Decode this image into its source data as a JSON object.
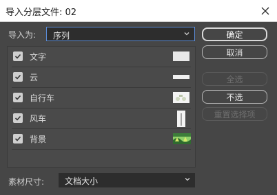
{
  "window": {
    "title": "导入分层文件: 02"
  },
  "import_as": {
    "label": "导入为:",
    "value": "序列"
  },
  "layers": [
    {
      "name": "文字",
      "checked": true
    },
    {
      "name": "云",
      "checked": true
    },
    {
      "name": "自行车",
      "checked": true
    },
    {
      "name": "风车",
      "checked": true
    },
    {
      "name": "背景",
      "checked": true
    }
  ],
  "footage": {
    "label": "素材尺寸:",
    "value": "文档大小"
  },
  "buttons": {
    "ok": "确定",
    "cancel": "取消",
    "select_all": "全选",
    "deselect": "不选",
    "reset": "重置选择项"
  },
  "colors": {
    "focus": "#5a8bd6",
    "panel": "#464646",
    "field": "#2d2d2d"
  }
}
